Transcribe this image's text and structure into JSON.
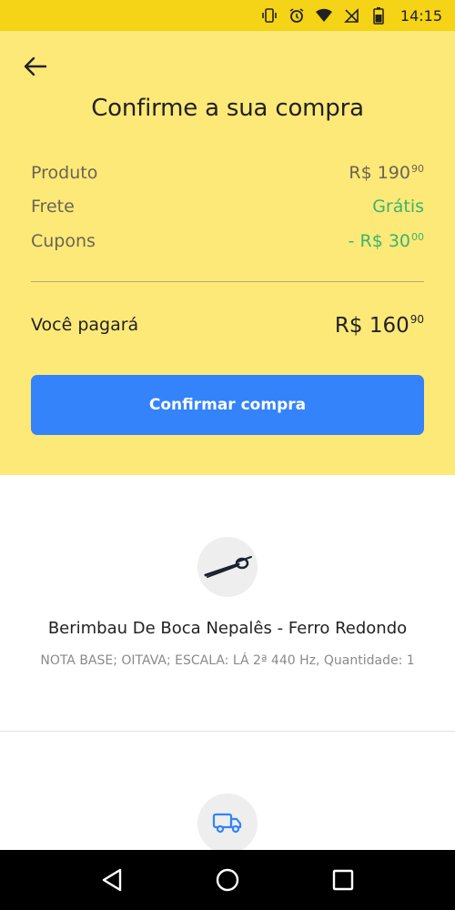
{
  "status_bar": {
    "time": "14:15",
    "icons": [
      "vibrate-icon",
      "alarm-icon",
      "wifi-icon",
      "no-signal-icon",
      "battery-icon"
    ]
  },
  "header": {
    "back_icon": "arrow-left-icon",
    "title": "Confirme a sua compra"
  },
  "summary": {
    "product_label": "Produto",
    "product_value": "R$ 190",
    "product_cents": "90",
    "shipping_label": "Frete",
    "shipping_value": "Grátis",
    "coupons_label": "Cupons",
    "coupons_value": "- R$ 30",
    "coupons_cents": "00",
    "total_label": "Você pagará",
    "total_value": "R$ 160",
    "total_cents": "90"
  },
  "confirm_button": {
    "label": "Confirmar compra"
  },
  "product": {
    "name": "Berimbau De Boca Nepalês - Ferro Redondo",
    "description": "NOTA BASE; OITAVA; ESCALA: LÁ 2ª 440 Hz, Quantidade: 1"
  },
  "shipping": {
    "icon": "truck-icon"
  },
  "nav_bar": {
    "icons": [
      "back-triangle-icon",
      "home-circle-icon",
      "recents-square-icon"
    ]
  },
  "colors": {
    "status_bar": "#f5d316",
    "header_bg": "#fde978",
    "accent_blue": "#3483fa",
    "green": "#3bb46d"
  }
}
